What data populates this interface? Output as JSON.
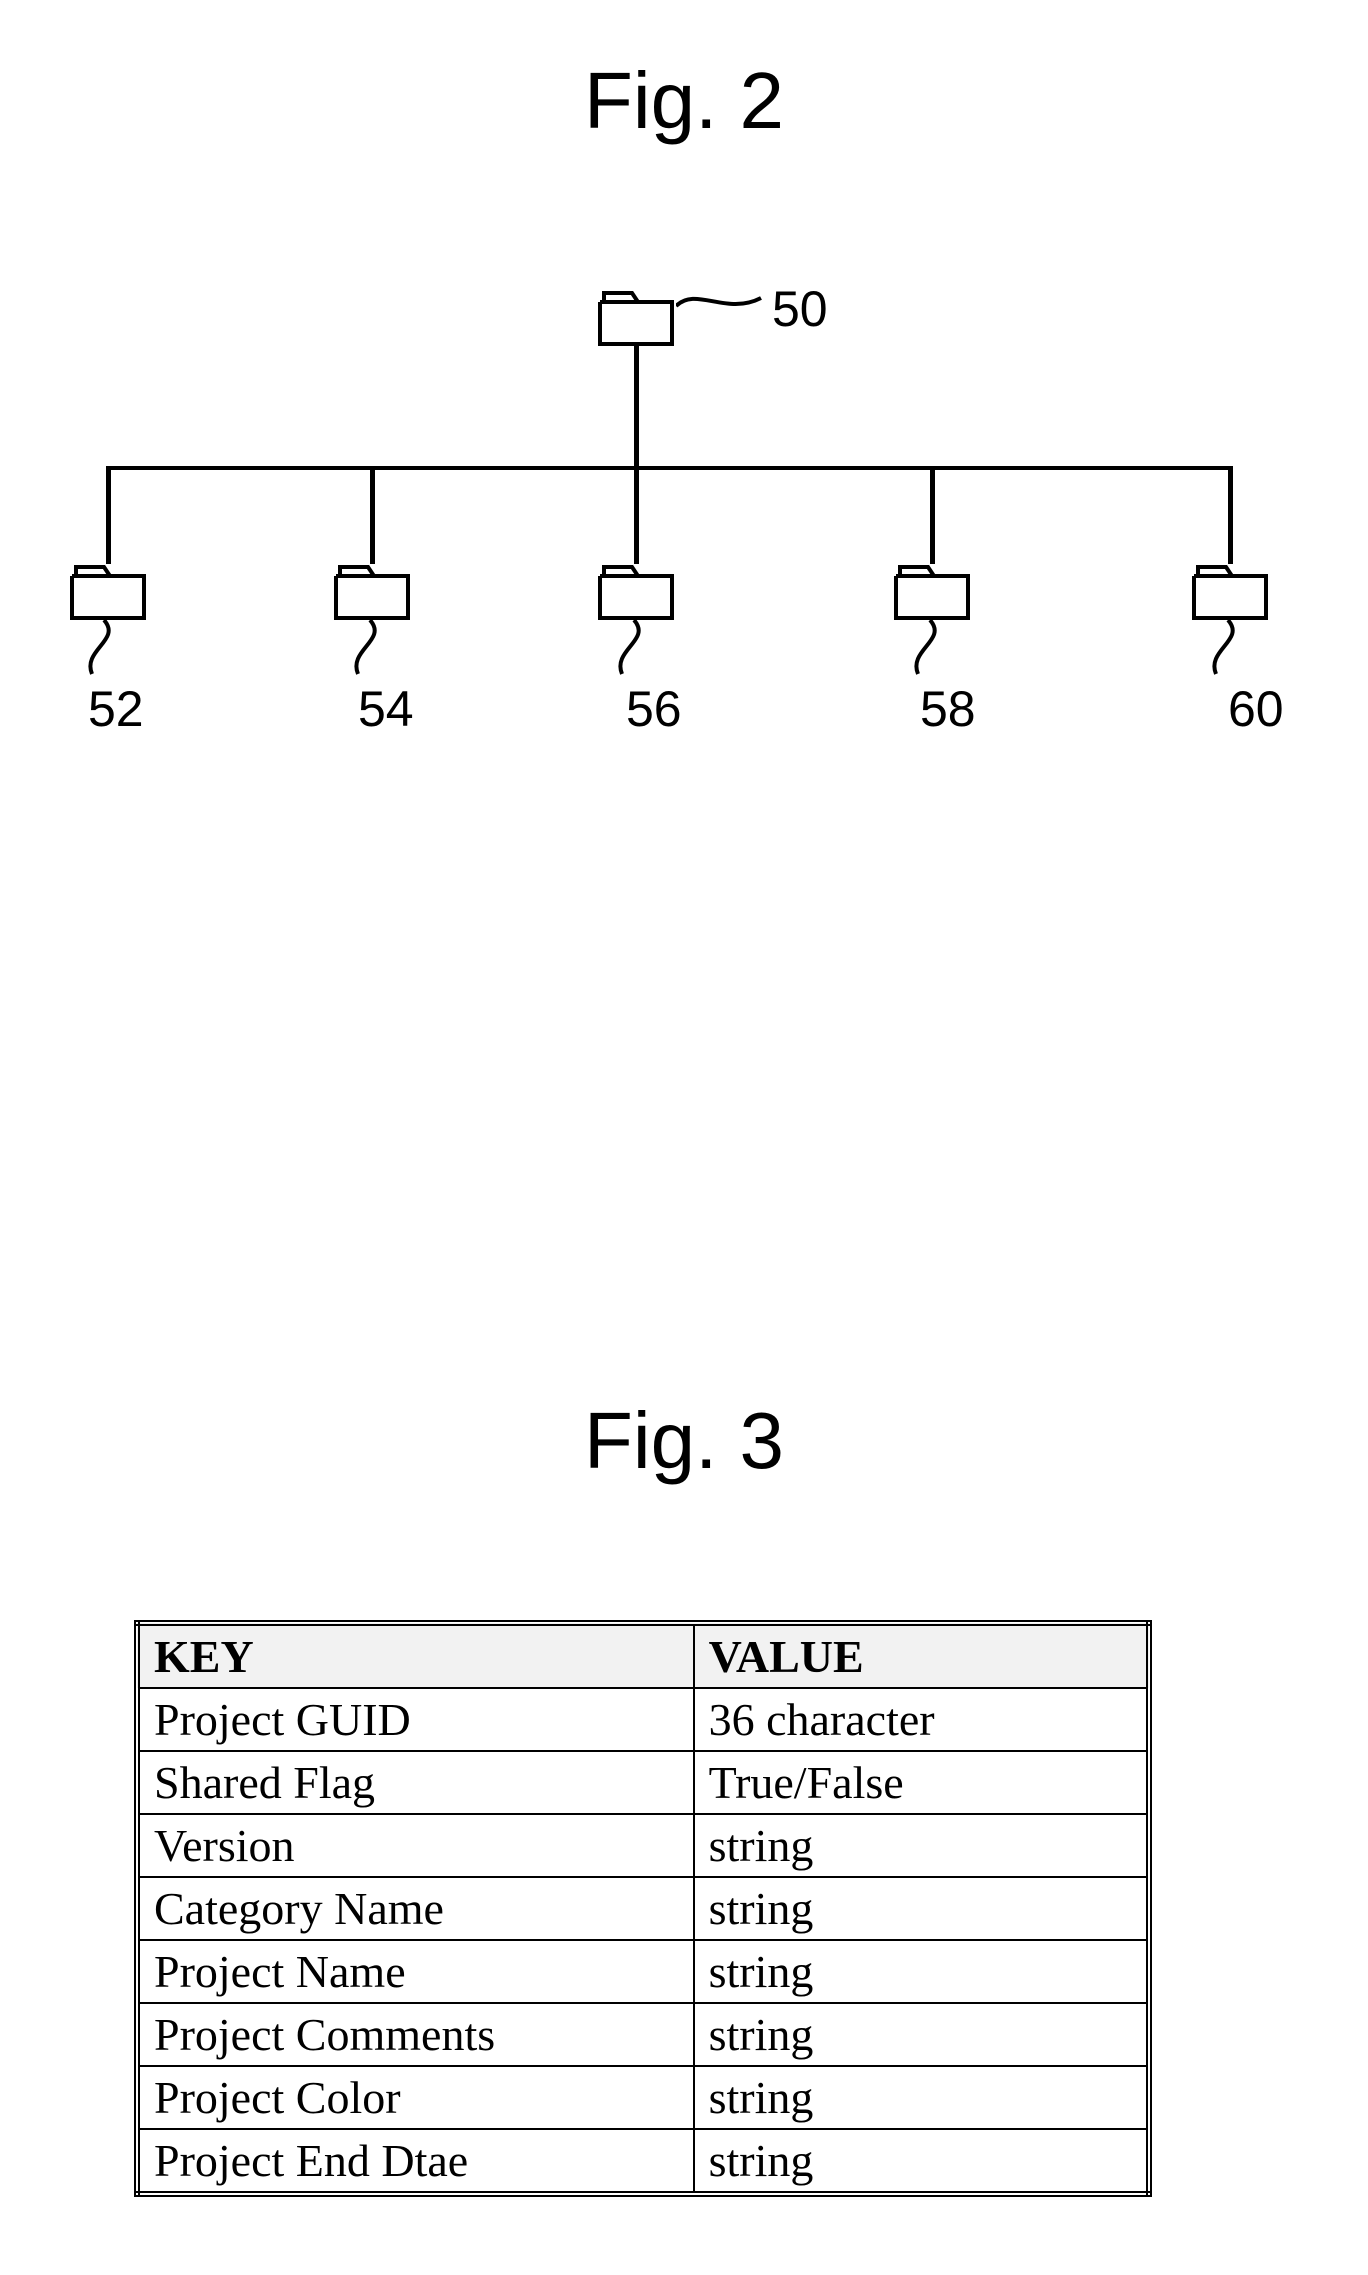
{
  "fig2": {
    "title": "Fig. 2",
    "root_label": "50",
    "children": [
      "52",
      "54",
      "56",
      "58",
      "60"
    ]
  },
  "fig3": {
    "title": "Fig. 3",
    "headers": {
      "key": "KEY",
      "value": "VALUE"
    },
    "rows": [
      {
        "key": "Project GUID",
        "value": "36 character"
      },
      {
        "key": "Shared Flag",
        "value": "True/False"
      },
      {
        "key": "Version",
        "value": "string"
      },
      {
        "key": "Category Name",
        "value": "string"
      },
      {
        "key": "Project Name",
        "value": "string"
      },
      {
        "key": "Project Comments",
        "value": "string"
      },
      {
        "key": "Project Color",
        "value": "string"
      },
      {
        "key": "Project End Dtae",
        "value": "string"
      }
    ]
  }
}
